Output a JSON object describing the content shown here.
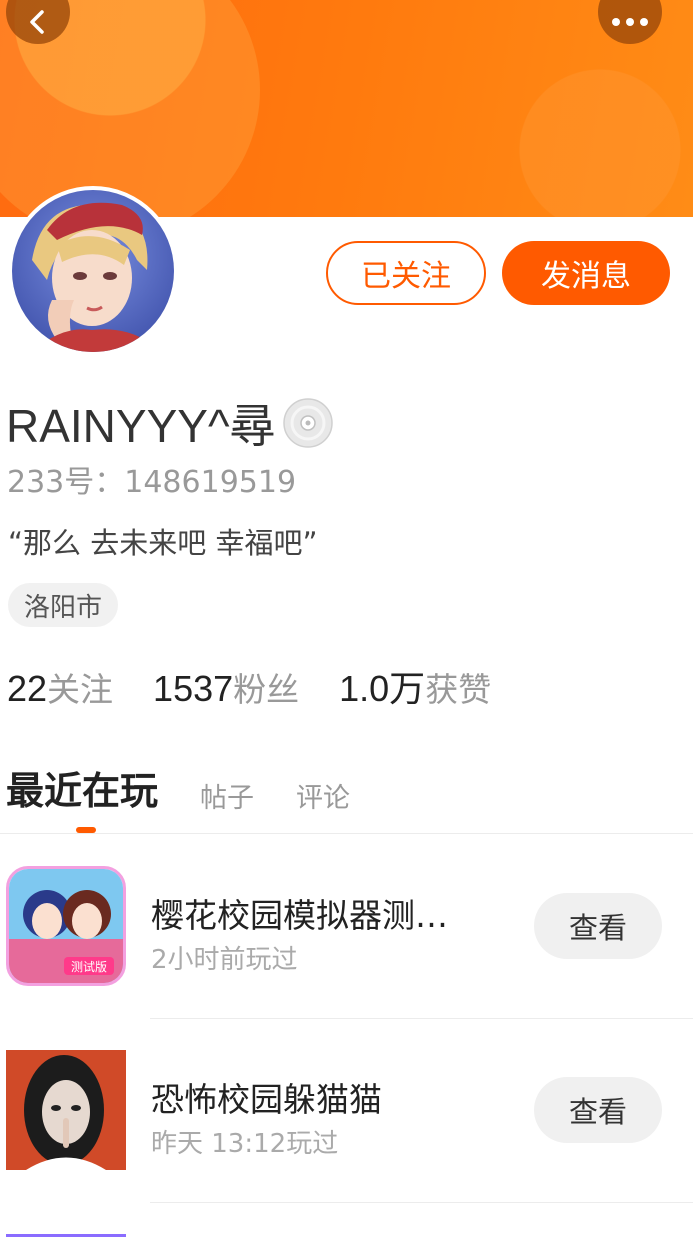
{
  "header": {
    "back_icon": "chevron-left-icon",
    "more_icon": "more-dots-icon"
  },
  "profile": {
    "avatar": "user-avatar",
    "follow_label": "已关注",
    "message_label": "发消息",
    "username": "RAINYYY^尋",
    "badge_icon": "disc-icon",
    "uid": "233号：148619519",
    "bio": "“那么 去未来吧 幸福吧”",
    "location": "洛阳市",
    "stats": [
      {
        "num": "22",
        "label": "关注"
      },
      {
        "num": "1537",
        "label": "粉丝"
      },
      {
        "num": "1.0万",
        "label": "获赞"
      }
    ]
  },
  "tabs": [
    {
      "label": "最近在玩",
      "active": true
    },
    {
      "label": "帖子",
      "active": false
    },
    {
      "label": "评论",
      "active": false
    }
  ],
  "games": [
    {
      "title": "樱花校园模拟器测…",
      "subtitle": "2小时前玩过",
      "action": "查看",
      "badge": "测试版"
    },
    {
      "title": "恐怖校园躲猫猫",
      "subtitle": "昨天 13:12玩过",
      "action": "查看"
    }
  ],
  "colors": {
    "accent": "#ff5a00",
    "banner": "#ff7a0e"
  }
}
